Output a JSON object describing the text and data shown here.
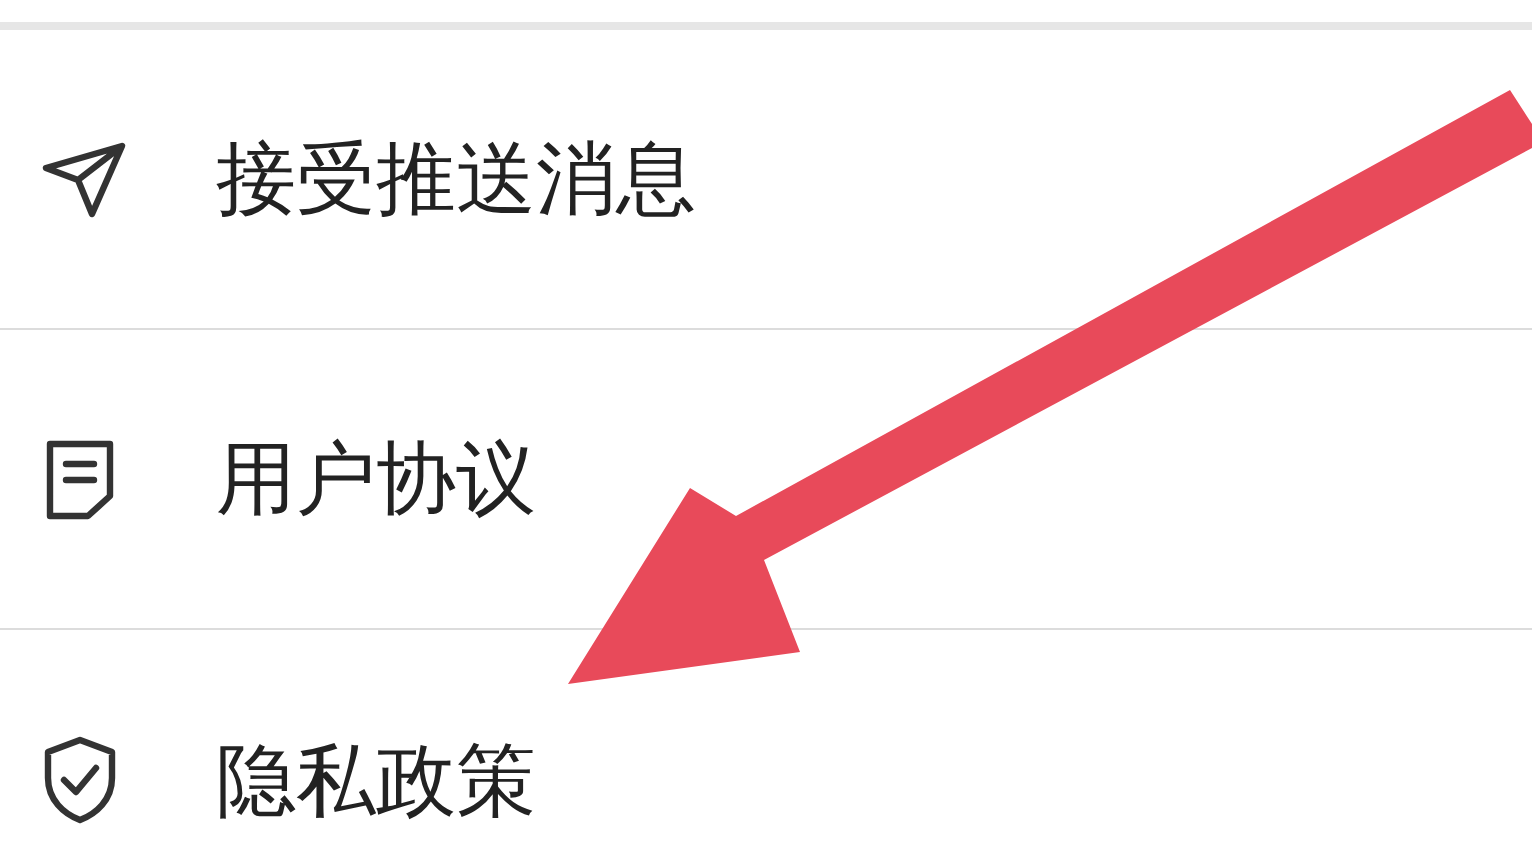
{
  "menu_items": [
    {
      "kind": "send",
      "label": "接受推送消息"
    },
    {
      "kind": "document",
      "label": "用户协议"
    },
    {
      "kind": "shield",
      "label": "隐私政策"
    }
  ]
}
